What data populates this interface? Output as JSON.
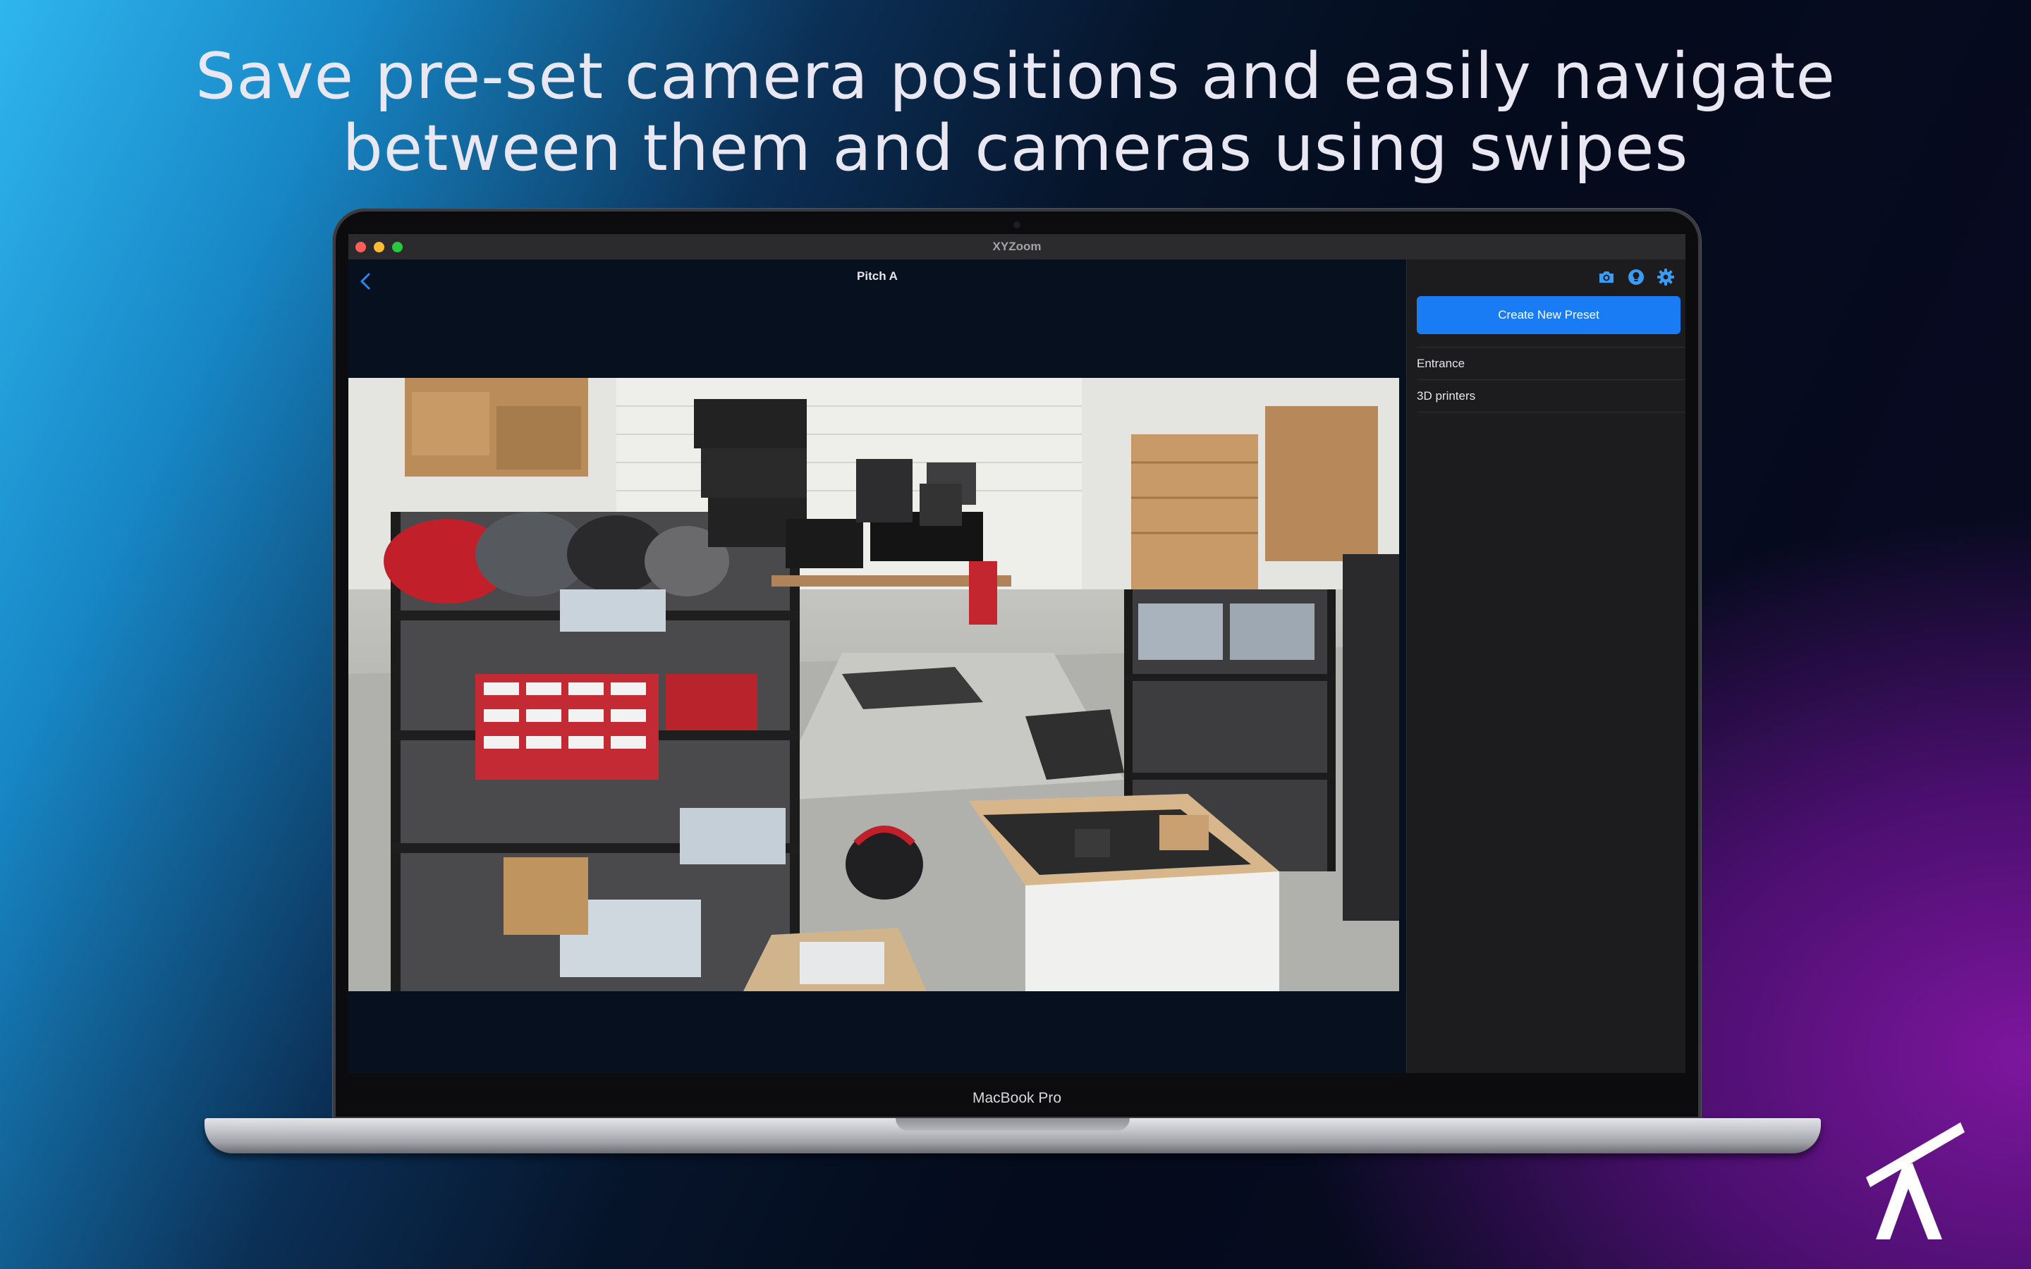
{
  "headline": {
    "line1": "Save pre-set camera positions and easily navigate",
    "line2": "between them and cameras using swipes"
  },
  "device": {
    "label": "MacBook Pro"
  },
  "window": {
    "title": "XYZoom"
  },
  "view": {
    "title": "Pitch A",
    "back_icon": "chevron-left-icon"
  },
  "sidebar": {
    "toolbar_icons": [
      "camera-icon",
      "bulb-icon",
      "gear-icon"
    ],
    "create_label": "Create New Preset",
    "presets": [
      {
        "label": "Entrance"
      },
      {
        "label": "3D printers"
      }
    ]
  },
  "colors": {
    "accent": "#1a7cf5",
    "icon_blue": "#3b9bf5",
    "sidebar_bg": "#1c1c1e",
    "main_bg": "#06101f"
  }
}
